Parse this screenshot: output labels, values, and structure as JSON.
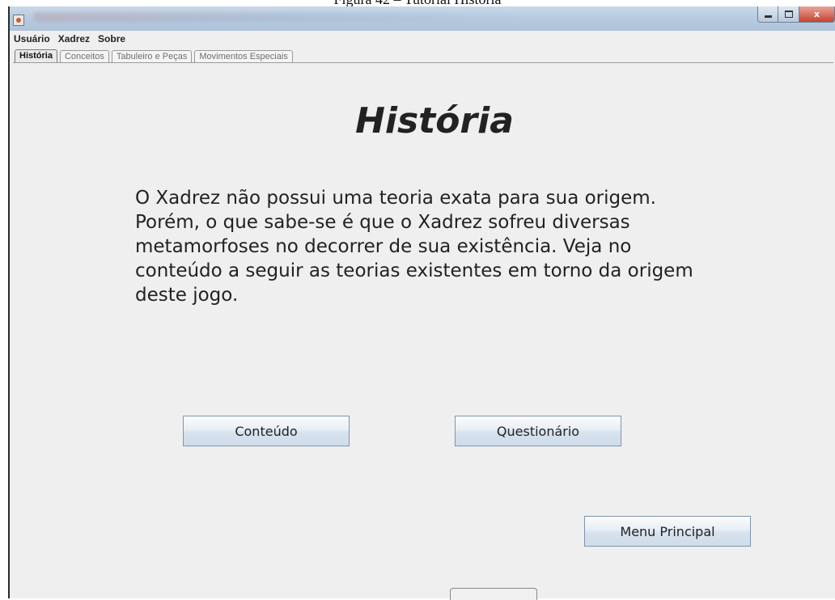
{
  "caption": "Figura 42 – Tutorial História",
  "menubar": {
    "items": [
      "Usuário",
      "Xadrez",
      "Sobre"
    ]
  },
  "tabs": [
    {
      "label": "História",
      "active": true
    },
    {
      "label": "Conceitos",
      "active": false
    },
    {
      "label": "Tabuleiro e Peças",
      "active": false
    },
    {
      "label": "Movimentos Especiais",
      "active": false
    }
  ],
  "panel": {
    "title": "História",
    "text": "O Xadrez não possui uma teoria exata para sua origem. Porém, o que sabe-se é que o Xadrez sofreu diversas metamorfoses no decorrer de sua existência. Veja no conteúdo a seguir as teorias existentes em torno da origem deste jogo.",
    "buttons": {
      "conteudo": "Conteúdo",
      "questionario": "Questionário",
      "menu_principal": "Menu Principal"
    }
  },
  "window_controls": {
    "close_glyph": "x"
  }
}
